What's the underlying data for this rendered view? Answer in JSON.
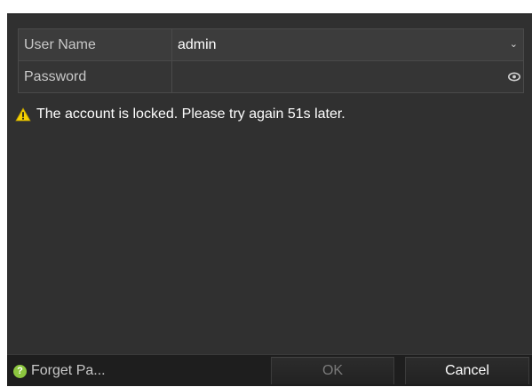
{
  "form": {
    "username_label": "User Name",
    "username_value": "admin",
    "password_label": "Password",
    "password_value": ""
  },
  "message": {
    "text": "The account is locked. Please try again 51s later."
  },
  "footer": {
    "forget_label": "Forget Pa...",
    "help_glyph": "?",
    "ok_label": "OK",
    "cancel_label": "Cancel"
  },
  "icons": {
    "dropdown": "chevron-down-icon",
    "password_toggle": "eye-icon",
    "warning": "warning-icon",
    "help": "help-icon"
  },
  "colors": {
    "dialog_bg": "#303030",
    "warning": "#f5d000",
    "help": "#8cc63f"
  },
  "state": {
    "ok_button_enabled": false
  }
}
